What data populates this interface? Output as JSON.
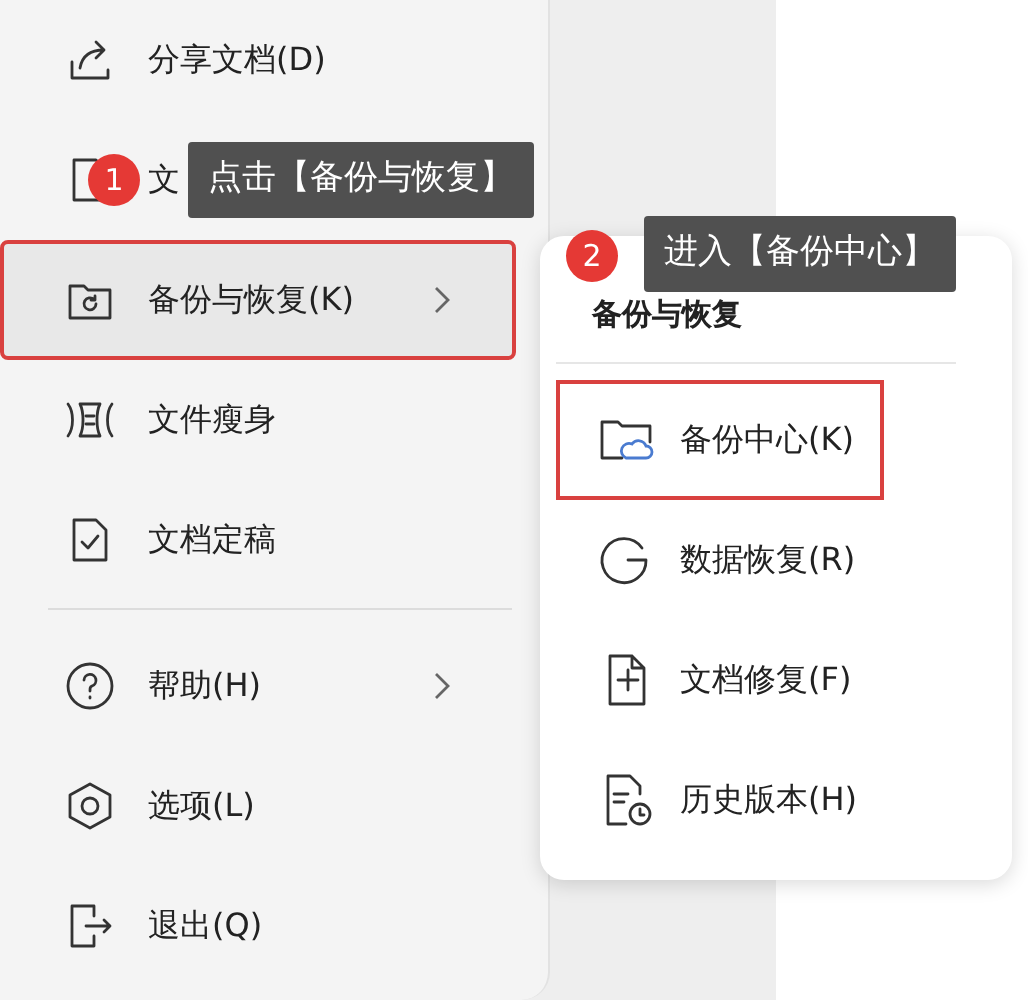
{
  "menu": {
    "items": [
      {
        "label": "分享文档(D)",
        "selected": false,
        "outlined": false,
        "submenu": false
      },
      {
        "label": "文",
        "selected": false,
        "outlined": false
      },
      {
        "label": "备份与恢复(K)",
        "selected": true,
        "outlined": true,
        "submenu": true
      },
      {
        "label": "文件瘦身",
        "selected": false,
        "outlined": false,
        "submenu": false
      },
      {
        "label": "文档定稿",
        "selected": false,
        "outlined": false,
        "submenu": false,
        "divider_after": true
      },
      {
        "label": "帮助(H)",
        "selected": false,
        "outlined": false,
        "submenu": true
      },
      {
        "label": "选项(L)",
        "selected": false,
        "outlined": false,
        "submenu": false
      },
      {
        "label": "退出(Q)",
        "selected": false,
        "outlined": false,
        "submenu": false
      }
    ]
  },
  "submenu": {
    "title": "备份与恢复",
    "items": [
      {
        "label": "备份中心(K)",
        "outlined": true
      },
      {
        "label": "数据恢复(R)",
        "outlined": false
      },
      {
        "label": "文档修复(F)",
        "outlined": false
      },
      {
        "label": "历史版本(H)",
        "outlined": false
      }
    ]
  },
  "callouts": [
    {
      "number": "1",
      "text": "点击【备份与恢复】"
    },
    {
      "number": "2",
      "text": "进入【备份中心】"
    }
  ]
}
